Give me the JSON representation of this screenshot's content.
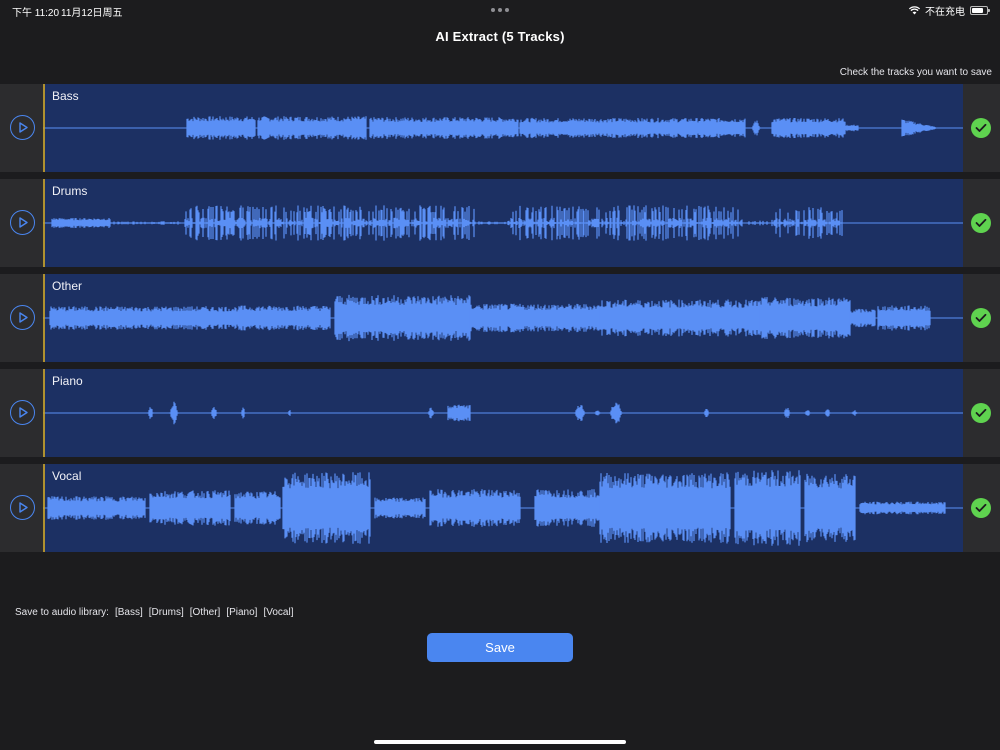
{
  "status_bar": {
    "time": "下午 11:20",
    "date": "11月12日周五",
    "charging": "不在充电",
    "battery_level": 0.8
  },
  "header": {
    "title": "AI Extract (5 Tracks)",
    "hint": "Check the tracks you want to save"
  },
  "tracks": [
    {
      "label": "Bass",
      "checked": true
    },
    {
      "label": "Drums",
      "checked": true
    },
    {
      "label": "Other",
      "checked": true
    },
    {
      "label": "Piano",
      "checked": true
    },
    {
      "label": "Vocal",
      "checked": true
    }
  ],
  "footer": {
    "save_library_prefix": "Save to audio library:",
    "save_library_items": [
      "[Bass]",
      "[Drums]",
      "[Other]",
      "[Piano]",
      "[Vocal]"
    ],
    "save_label": "Save"
  },
  "colors": {
    "accent": "#4a86f0",
    "waveform": "#5a8ff5",
    "track_bg": "#1c3063",
    "check": "#5fd34f",
    "playhead": "#c9a227"
  }
}
